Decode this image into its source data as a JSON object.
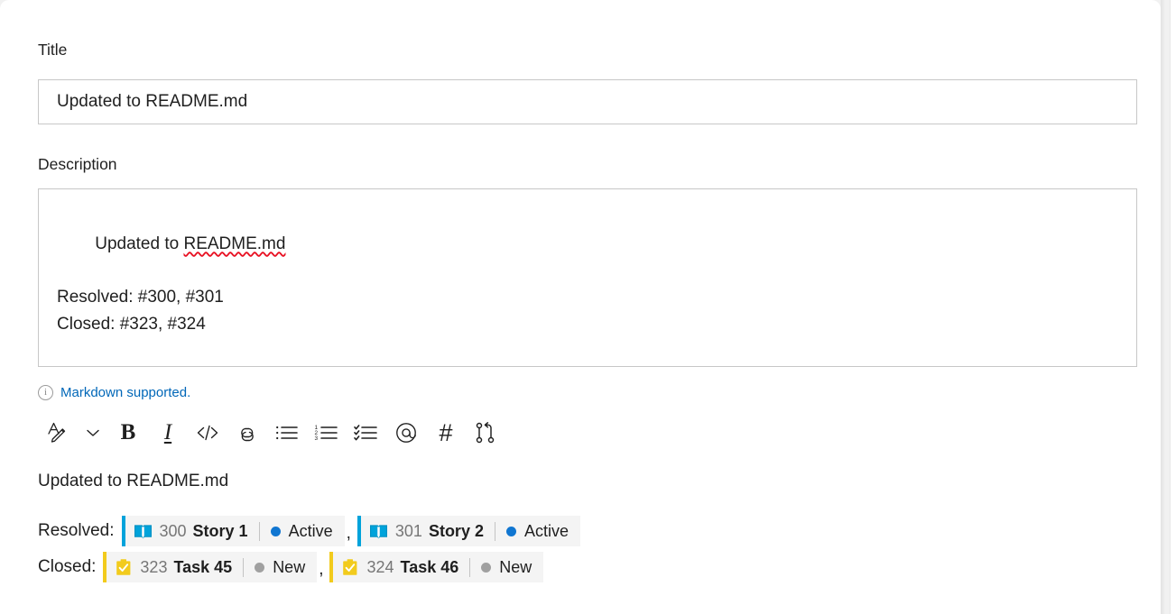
{
  "form": {
    "title_label": "Title",
    "title_value": "Updated to README.md",
    "title_placeholder": "Enter title",
    "description_label": "Description",
    "description_line1_prefix": "Updated to ",
    "description_line1_misspelled": "README.md",
    "description_line2": "",
    "description_line3": "Resolved: #300, #301",
    "description_line4": "Closed: #323, #324",
    "markdown_hint": "Markdown supported.",
    "markdown_hint_icon": "info-icon",
    "markdown_hint_color": "#0067b8"
  },
  "toolbar": {
    "items": [
      {
        "name": "text-style-icon",
        "label": "Text style"
      },
      {
        "name": "chevron-down-icon",
        "label": "More text styles"
      },
      {
        "name": "bold-icon",
        "label": "B"
      },
      {
        "name": "italic-icon",
        "label": "I"
      },
      {
        "name": "code-icon",
        "label": "</>"
      },
      {
        "name": "link-icon",
        "label": "Link"
      },
      {
        "name": "bulleted-list-icon",
        "label": "Bulleted list"
      },
      {
        "name": "numbered-list-icon",
        "label": "Numbered list"
      },
      {
        "name": "checklist-icon",
        "label": "Checklist"
      },
      {
        "name": "mention-icon",
        "label": "@"
      },
      {
        "name": "hashtag-icon",
        "label": "#"
      },
      {
        "name": "pull-request-icon",
        "label": "Pull request"
      }
    ]
  },
  "preview": {
    "heading": "Updated to README.md",
    "rows": [
      {
        "label": "Resolved:",
        "chips": [
          {
            "type": "user-story",
            "icon": "book-icon",
            "accent": "#00a3db",
            "id": "300",
            "title": "Story 1",
            "state": "Active",
            "state_color": "#1076d1"
          },
          {
            "type": "user-story",
            "icon": "book-icon",
            "accent": "#00a3db",
            "id": "301",
            "title": "Story 2",
            "state": "Active",
            "state_color": "#1076d1"
          }
        ],
        "separator": ","
      },
      {
        "label": "Closed:",
        "chips": [
          {
            "type": "task",
            "icon": "clipboard-check-icon",
            "accent": "#f2cb1d",
            "id": "323",
            "title": "Task 45",
            "state": "New",
            "state_color": "#a0a0a0"
          },
          {
            "type": "task",
            "icon": "clipboard-check-icon",
            "accent": "#f2cb1d",
            "id": "324",
            "title": "Task 46",
            "state": "New",
            "state_color": "#a0a0a0"
          }
        ],
        "separator": ","
      }
    ]
  }
}
